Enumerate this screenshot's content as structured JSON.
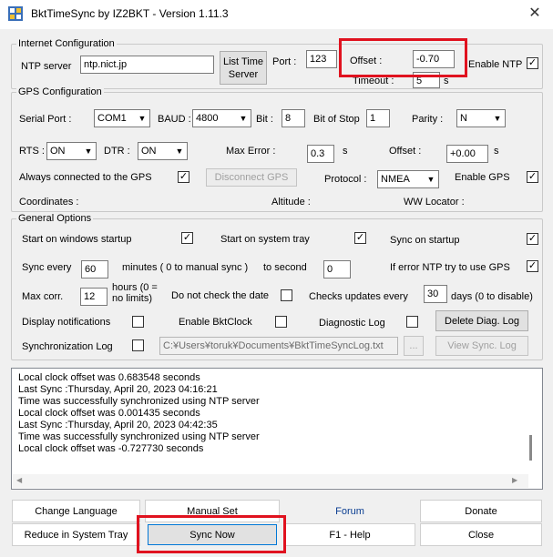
{
  "window": {
    "title": "BktTimeSync by IZ2BKT - Version 1.11.3",
    "close_glyph": "✕"
  },
  "internet": {
    "legend": "Internet Configuration",
    "ntp_server_label": "NTP server",
    "ntp_server_value": "ntp.nict.jp",
    "list_time_server_line1": "List Time",
    "list_time_server_line2": "Server",
    "port_label": "Port :",
    "port_value": "123",
    "offset_label": "Offset :",
    "offset_value": "-0.70",
    "enable_ntp_label": "Enable NTP",
    "enable_ntp_checked": "✓",
    "timeout_label": "Timeout :",
    "timeout_value": "5",
    "timeout_unit": "s"
  },
  "gps": {
    "legend": "GPS Configuration",
    "serial_port_label": "Serial Port :",
    "serial_port_value": "COM1",
    "baud_label": "BAUD :",
    "baud_value": "4800",
    "bit_label": "Bit :",
    "bit_value": "8",
    "bit_of_stop_label": "Bit of Stop",
    "bit_of_stop_value": "1",
    "parity_label": "Parity :",
    "parity_value": "N",
    "rts_label": "RTS :",
    "rts_value": "ON",
    "dtr_label": "DTR :",
    "dtr_value": "ON",
    "max_error_label": "Max Error :",
    "max_error_value": "0.3",
    "max_error_unit": "s",
    "offset_label": "Offset :",
    "offset_value": "+0.00",
    "offset_unit": "s",
    "always_connected_label": "Always connected to the GPS",
    "always_connected_checked": "✓",
    "disconnect_button": "Disconnect GPS",
    "protocol_label": "Protocol :",
    "protocol_value": "NMEA",
    "enable_gps_label": "Enable GPS",
    "enable_gps_checked": "✓",
    "coordinates_label": "Coordinates :",
    "altitude_label": "Altitude :",
    "ww_locator_label": "WW Locator :"
  },
  "general": {
    "legend": "General Options",
    "start_windows_label": "Start on windows startup",
    "start_windows_checked": "✓",
    "start_tray_label": "Start on system tray",
    "start_tray_checked": "✓",
    "sync_startup_label": "Sync on startup",
    "sync_startup_checked": "✓",
    "sync_every_label": "Sync every",
    "sync_every_value": "60",
    "minutes_label": "minutes ( 0 to manual sync )",
    "to_second_label": "to second",
    "to_second_value": "0",
    "if_error_label": "If error NTP try to use GPS",
    "if_error_checked": "✓",
    "max_corr_label": "Max corr.",
    "max_corr_value": "12",
    "hours_line1": "hours (0 =",
    "hours_line2": "no limits)",
    "not_check_date_label": "Do not check the date",
    "checks_updates_label": "Checks updates every",
    "checks_updates_value": "30",
    "days_label": "days (0 to disable)",
    "display_notif_label": "Display notifications",
    "enable_bktclock_label": "Enable BktClock",
    "diagnostic_log_label": "Diagnostic Log",
    "delete_diag_button": "Delete Diag. Log",
    "sync_log_label": "Synchronization Log",
    "sync_log_path": "C:¥Users¥toruk¥Documents¥BktTimeSyncLog.txt",
    "browse_button": "...",
    "view_sync_button": "View Sync. Log"
  },
  "log": {
    "lines": [
      "Local clock offset was 0.683548 seconds",
      "Last Sync :Thursday, April 20, 2023 04:16:21",
      "Time was successfully synchronized using NTP server",
      "Local clock offset was 0.001435 seconds",
      "Last Sync :Thursday, April 20, 2023 04:42:35",
      "Time was successfully synchronized using NTP server",
      "Local clock offset was -0.727730 seconds"
    ],
    "scroll_left": "◀",
    "scroll_right": "▶"
  },
  "bottom": {
    "change_language": "Change Language",
    "manual_set": "Manual Set",
    "forum": "Forum",
    "donate": "Donate",
    "reduce_tray": "Reduce in System Tray",
    "sync_now": "Sync Now",
    "f1_help": "F1 - Help",
    "close": "Close"
  },
  "colors": {
    "highlight": "#e0121f",
    "link": "#0a3d91"
  }
}
